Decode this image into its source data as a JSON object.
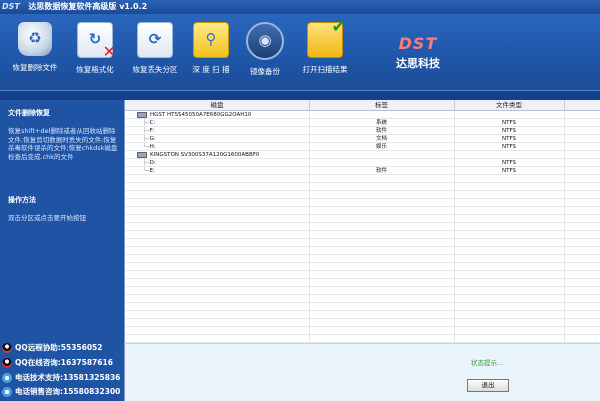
{
  "window": {
    "logo": "DST",
    "title": "达思数据恢复软件高级版 v1.0.2"
  },
  "toolbar": {
    "items": [
      {
        "label": "恢复删除文件",
        "icon": "recycle-bin-icon"
      },
      {
        "label": "恢复格式化",
        "icon": "format-recover-icon"
      },
      {
        "label": "恢复丢失分区",
        "icon": "partition-recover-icon"
      },
      {
        "label": "深 度 扫 描",
        "icon": "deep-scan-icon"
      },
      {
        "label": "镜像备份",
        "icon": "disk-image-icon"
      },
      {
        "label": "打开扫描结果",
        "icon": "open-folder-icon"
      }
    ]
  },
  "brand": {
    "logo": "DST",
    "name": "达思科技"
  },
  "sidebar": {
    "section1_title": "文件删除恢复",
    "section1_text": "恢复shift+del删除或者从回收站删除文件;恢复剪切数据时丢失的文件;恢复杀毒软件误杀的文件;恢复chkdsk磁盘检查后变成.chk的文件",
    "section2_title": "操作方法",
    "section2_text": "双击分区或点击要开始按钮",
    "contacts": [
      {
        "label": "QQ远程协助:55356052",
        "icon": "qq-icon"
      },
      {
        "label": "QQ在线咨询:1637587616",
        "icon": "qq-icon"
      },
      {
        "label": "电话技术支持:13581325836",
        "icon": "phone-icon"
      },
      {
        "label": "电话销售咨询:15580832300",
        "icon": "phone-icon"
      }
    ]
  },
  "grid": {
    "headers": [
      "磁盘",
      "标签",
      "文件类型"
    ],
    "rows": [
      {
        "disk": "HGST HTS545050A7E680GG2OAH10",
        "label": "",
        "fs": "",
        "level": 0
      },
      {
        "disk": "C:",
        "label": "系统",
        "fs": "NTFS",
        "level": 1
      },
      {
        "disk": "F:",
        "label": "软件",
        "fs": "NTFS",
        "level": 1
      },
      {
        "disk": "G:",
        "label": "文档",
        "fs": "NTFS",
        "level": 1
      },
      {
        "disk": "H:",
        "label": "娱乐",
        "fs": "NTFS",
        "level": 1
      },
      {
        "disk": "KINGSTON SV300S37A120G1600ABBF0",
        "label": "",
        "fs": "",
        "level": 0
      },
      {
        "disk": "D:",
        "label": "",
        "fs": "NTFS",
        "level": 1
      },
      {
        "disk": "E:",
        "label": "软件",
        "fs": "NTFS",
        "level": 1
      }
    ]
  },
  "status": {
    "hint": "状态提示...",
    "exit_label": "退出"
  }
}
